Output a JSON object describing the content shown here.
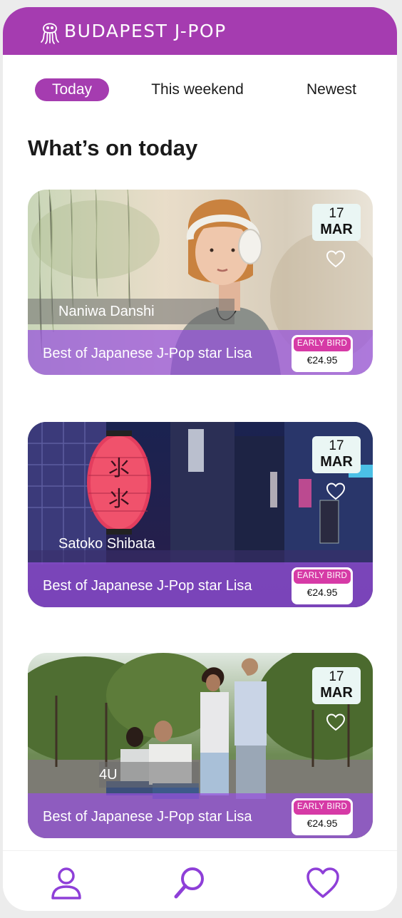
{
  "app": {
    "brand": "BUDAPEST J-POP",
    "logo_icon": "octopus-logo-icon",
    "accent_color": "#a53cb0"
  },
  "tabs": [
    {
      "label": "Today",
      "active": true
    },
    {
      "label": "This weekend",
      "active": false
    },
    {
      "label": "Newest",
      "active": false
    }
  ],
  "section_title": "What’s on today",
  "events": [
    {
      "artist": "Naniwa Danshi",
      "title": "Best of Japanese J-Pop star Lisa",
      "day": "17",
      "month": "MAR",
      "badge": "EARLY BIRD",
      "price": "€24.95",
      "favorite_icon": "heart-icon"
    },
    {
      "artist": "Satoko Shibata",
      "title": "Best of Japanese J-Pop star Lisa",
      "day": "17",
      "month": "MAR",
      "badge": "EARLY BIRD",
      "price": "€24.95",
      "favorite_icon": "heart-icon"
    },
    {
      "artist": "4U",
      "title": "Best of Japanese J-Pop star Lisa",
      "day": "17",
      "month": "MAR",
      "badge": "EARLY BIRD",
      "price": "€24.95",
      "favorite_icon": "heart-icon"
    }
  ],
  "bottom_nav": [
    {
      "icon": "user-icon"
    },
    {
      "icon": "search-icon"
    },
    {
      "icon": "heart-icon"
    }
  ]
}
